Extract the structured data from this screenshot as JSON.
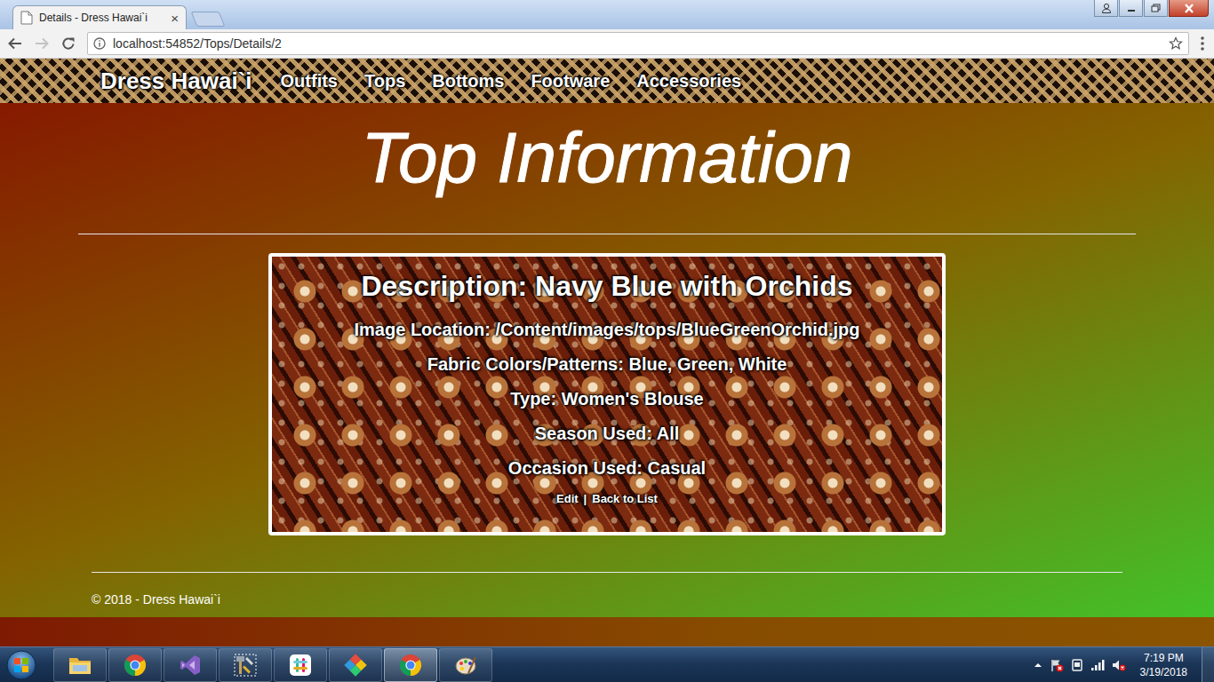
{
  "browser": {
    "tab": {
      "title": "Details - Dress Hawai`i",
      "close": "×",
      "selected": true
    },
    "url": "localhost:54852/Tops/Details/2",
    "forward_enabled": false
  },
  "navbar": {
    "brand": "Dress Hawai`i",
    "items": [
      {
        "label": "Outfits"
      },
      {
        "label": "Tops"
      },
      {
        "label": "Bottoms"
      },
      {
        "label": "Footware"
      },
      {
        "label": "Accessories"
      }
    ]
  },
  "page": {
    "heading": "Top Information",
    "details": {
      "title": "Description: Navy Blue with Orchids",
      "fields": [
        "Image Location: /Content/images/tops/BlueGreenOrchid.jpg",
        "Fabric Colors/Patterns: Blue, Green, White",
        "Type: Women's Blouse",
        "Season Used: All",
        "Occasion Used: Casual"
      ],
      "links": [
        "Edit",
        "Back to List"
      ],
      "separator": "|"
    }
  },
  "footer": "© 2018 - Dress Hawai`i",
  "taskbar": {
    "apps": [
      {
        "kind": "explorer",
        "selected": false
      },
      {
        "kind": "chrome",
        "selected": false
      },
      {
        "kind": "visualstudio",
        "selected": false
      },
      {
        "kind": "tools",
        "selected": false
      },
      {
        "kind": "slack",
        "selected": false
      },
      {
        "kind": "gitkraken",
        "selected": false
      },
      {
        "kind": "chrome",
        "selected": true
      },
      {
        "kind": "paint",
        "selected": false
      }
    ],
    "time": "7:19 PM",
    "date": "3/19/2018"
  }
}
